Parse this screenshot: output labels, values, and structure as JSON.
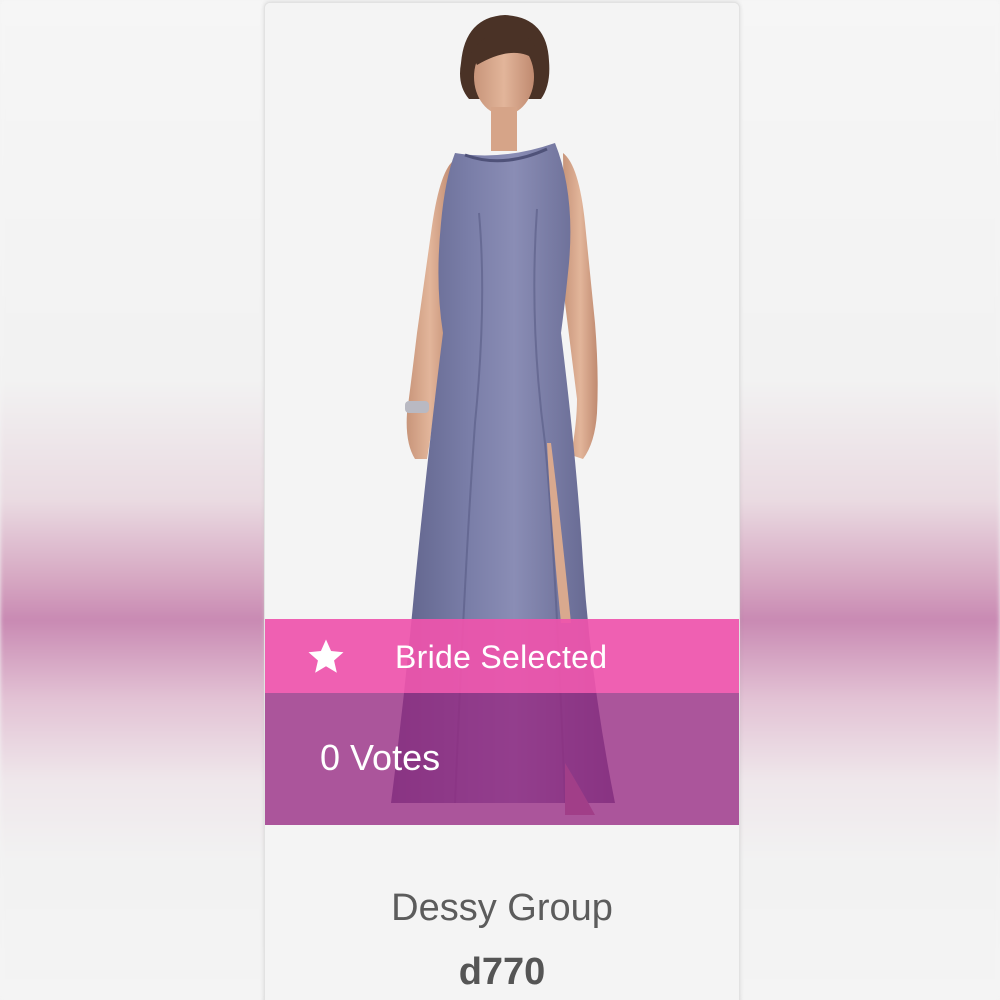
{
  "product": {
    "badge_icon": "star-icon",
    "selected_label": "Bride Selected",
    "votes_label": "0 Votes",
    "brand": "Dessy Group",
    "sku": "d770"
  },
  "colors": {
    "selected_band": "#EE54AC",
    "votes_band": "#962882",
    "dress": "#6E7199",
    "text_muted": "#5C5C5C"
  }
}
